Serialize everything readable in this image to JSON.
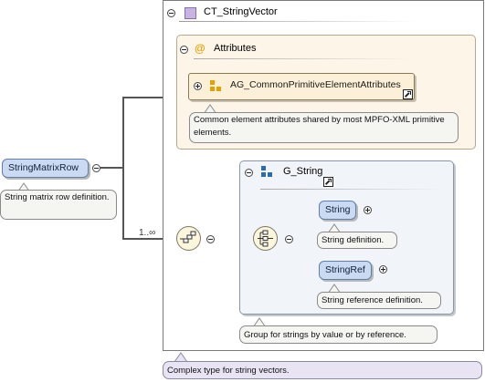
{
  "complex_type": {
    "name": "CT_StringVector",
    "annotation": "Complex type for string vectors."
  },
  "attributes": {
    "title": "Attributes",
    "group_name": "AG_CommonPrimitiveElementAttributes",
    "annotation": "Common element attributes shared by most MPFO-XML primitive elements."
  },
  "root_element": {
    "name": "StringMatrixRow",
    "annotation": "String matrix row definition."
  },
  "sequence": {
    "occurrence": "1..∞"
  },
  "group": {
    "name": "G_String",
    "annotation": "Group for strings by value or by reference."
  },
  "children": [
    {
      "name": "String",
      "annotation": "String definition."
    },
    {
      "name": "StringRef",
      "annotation": "String reference definition."
    }
  ],
  "colors": {
    "element_fill": "#c9daf2",
    "attributes_fill": "#fdf6e8",
    "group_fill": "#f1f4f8",
    "type_icon": "#c8b4e0",
    "group_icon": "#2a6cb0",
    "attribute_icon": "#e8a000"
  }
}
